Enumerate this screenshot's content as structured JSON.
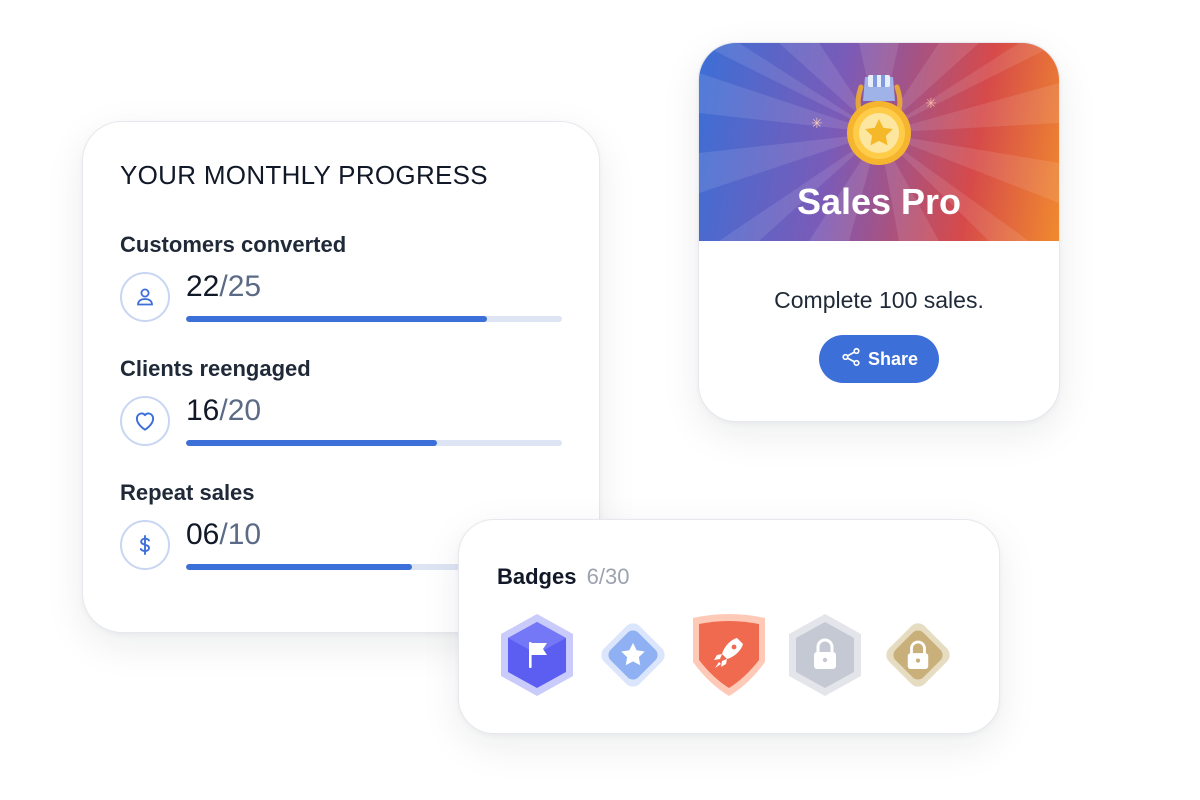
{
  "progress": {
    "title": "YOUR MONTHLY PROGRESS",
    "metrics": [
      {
        "label": "Customers converted",
        "current": "22",
        "target": "/25",
        "progress": 0.8,
        "icon": "user-icon"
      },
      {
        "label": "Clients reengaged",
        "current": "16",
        "target": "/20",
        "progress": 0.667,
        "icon": "heart-icon"
      },
      {
        "label": "Repeat sales",
        "current": "06",
        "target": "/10",
        "progress": 0.6,
        "icon": "dollar-icon"
      }
    ]
  },
  "achievement": {
    "title": "Sales Pro",
    "description": "Complete 100 sales.",
    "share_label": "Share",
    "icon": "medal-star-icon"
  },
  "badges": {
    "title": "Badges",
    "count": "6/30",
    "items": [
      {
        "name": "flag-badge",
        "state": "unlocked",
        "color": "#5b5ef0"
      },
      {
        "name": "star-badge",
        "state": "unlocked",
        "color": "#8fb0f2"
      },
      {
        "name": "rocket-badge",
        "state": "unlocked",
        "color": "#f06a4f"
      },
      {
        "name": "locked-badge",
        "state": "locked",
        "color": "#c5c9d3"
      },
      {
        "name": "locked-badge",
        "state": "locked",
        "color": "#c9b07a"
      }
    ]
  },
  "colors": {
    "accent": "#3d6fd8",
    "bar_track": "#dde5f5",
    "text_muted": "#5b6b86"
  }
}
